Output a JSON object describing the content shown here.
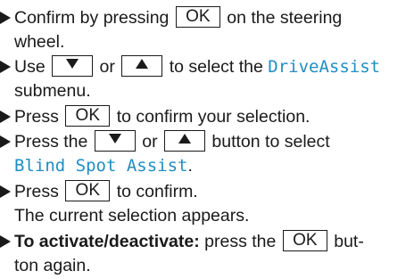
{
  "colors": {
    "text": "#1a1a1a",
    "menu_text": "#1f8ec4"
  },
  "icons": {
    "bullet": "right-triangle-bullet",
    "down": "down-triangle",
    "up": "up-triangle"
  },
  "keys": {
    "ok": "OK"
  },
  "steps": [
    {
      "a": "Confirm by pressing",
      "b": "on the steering",
      "cont": "wheel."
    },
    {
      "a": "Use",
      "mid": "or",
      "b": "to select the",
      "menu": "DriveAssist",
      "cont": "submenu."
    },
    {
      "a": "Press",
      "b": "to confirm your selection."
    },
    {
      "a": "Press the",
      "mid": "or",
      "b": "button to select",
      "menu_line2": "Blind Spot Assist",
      "period": "."
    },
    {
      "a": "Press",
      "b": "to confirm.",
      "cont": "The current selection appears."
    },
    {
      "bold": "To activate/deactivate:",
      "a": "press the",
      "b": "but-",
      "cont": "ton again."
    }
  ]
}
